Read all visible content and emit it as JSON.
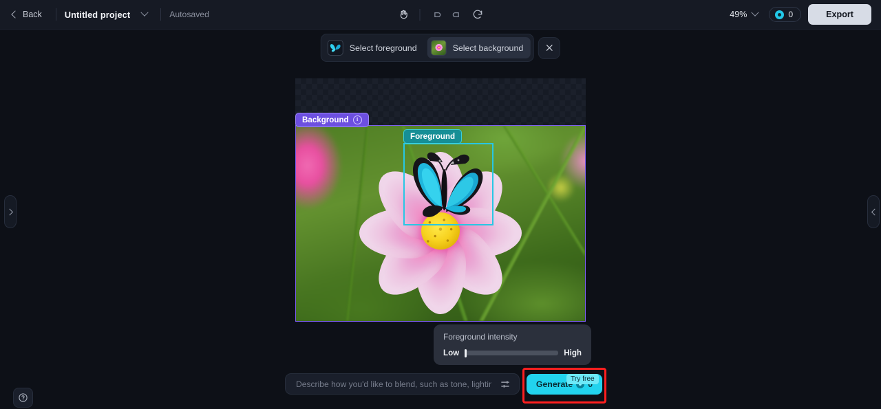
{
  "app": {
    "background_color": "#0d1017",
    "accent_cyan": "#22d3ee",
    "accent_purple": "#6d4fe0",
    "accent_teal": "#168f96",
    "highlight_color": "#ff1f1f"
  },
  "topbar": {
    "back_label": "Back",
    "project_name": "Untitled project",
    "project_caret_icon": "chevron-down-icon",
    "autosave_status": "Autosaved",
    "tools": [
      {
        "name": "hand-tool-icon",
        "label": "Hand tool"
      },
      {
        "name": "undo-icon",
        "label": "Undo"
      },
      {
        "name": "redo-icon",
        "label": "Redo"
      },
      {
        "name": "reset-icon",
        "label": "Reset"
      }
    ],
    "zoom_level": "49%",
    "zoom_caret_icon": "chevron-down-icon",
    "credits_icon": "coin-icon",
    "credits_value": "0",
    "export_label": "Export"
  },
  "modebar": {
    "foreground": {
      "label": "Select foreground",
      "thumbnail": "butterfly-thumbnail",
      "active": false
    },
    "background": {
      "label": "Select background",
      "thumbnail": "flower-thumbnail",
      "active": true
    },
    "close_icon": "close-icon"
  },
  "canvas": {
    "background_badge": {
      "label": "Background",
      "info_icon": "info-icon"
    },
    "foreground_badge": {
      "label": "Foreground"
    },
    "selection_box_color": "#27c7e4",
    "layer_border_color": "#7b5cf0"
  },
  "intensity_panel": {
    "title": "Foreground intensity",
    "low_label": "Low",
    "high_label": "High",
    "value_percent": 0
  },
  "prompt": {
    "placeholder": "Describe how you'd like to blend, such as tone, lighting...",
    "value": "",
    "settings_icon": "sliders-icon"
  },
  "generate": {
    "label": "Generate",
    "cost_icon": "coin-icon",
    "cost_value": "0",
    "badge_label": "Try free"
  },
  "panels": {
    "left_handle_icon": "chevron-right-icon",
    "right_handle_icon": "chevron-left-icon",
    "help_icon": "help-icon"
  }
}
